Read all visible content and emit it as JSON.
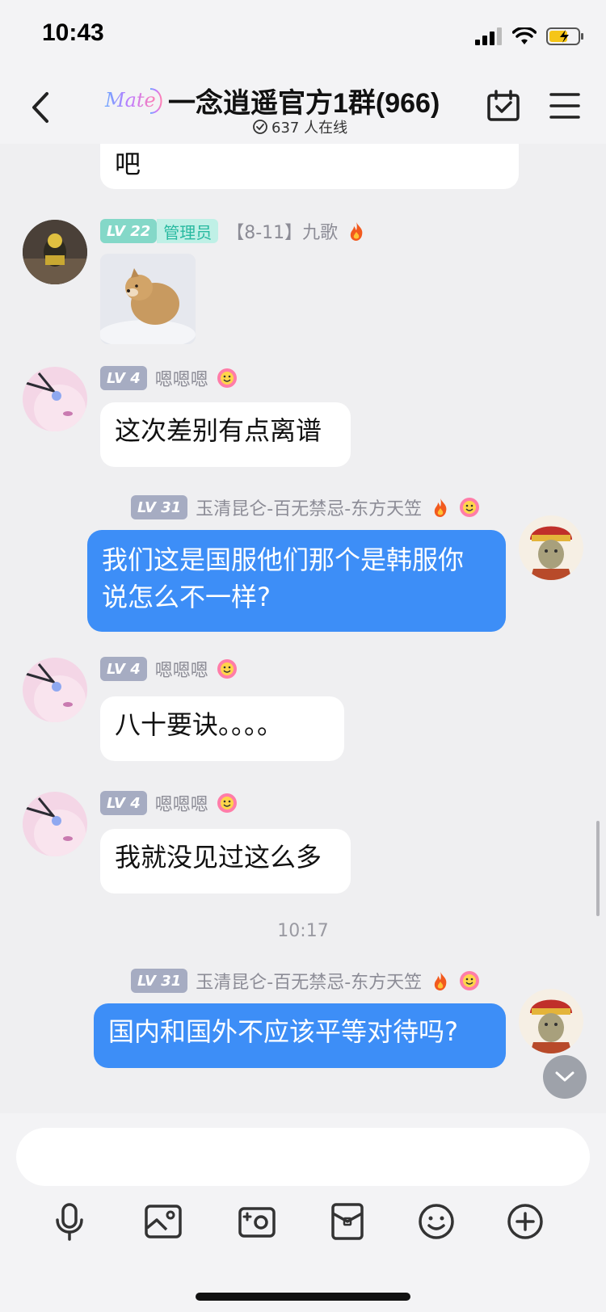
{
  "status_bar": {
    "time": "10:43"
  },
  "header": {
    "brand": "Mate",
    "group_title": "一念逍遥官方1群(966)",
    "online_text": "637 人在线"
  },
  "messages": [
    {
      "id": "m0",
      "text": "吧"
    },
    {
      "id": "m1",
      "level": "LV 22",
      "role": "管理员",
      "nickname": "【8-11】九歌",
      "type": "image"
    },
    {
      "id": "m2",
      "level": "LV 4",
      "nickname": "嗯嗯嗯",
      "text": "这次差别有点离谱"
    },
    {
      "id": "m3",
      "level": "LV 31",
      "nickname": "玉清昆仑-百无禁忌-东方天笠",
      "text_line1": "我们这是国服他们那个是韩服你",
      "text_line2": "说怎么不一样?",
      "self": true
    },
    {
      "id": "m4",
      "level": "LV 4",
      "nickname": "嗯嗯嗯",
      "text": "八十要诀。。。。"
    },
    {
      "id": "m5",
      "level": "LV 4",
      "nickname": "嗯嗯嗯",
      "text": "我就没见过这么多"
    },
    {
      "id": "m6",
      "level": "LV 31",
      "nickname": "玉清昆仑-百无禁忌-东方天笠",
      "text": "国内和国外不应该平等对待吗?",
      "self": true
    }
  ],
  "timestamp": "10:17",
  "input": {
    "placeholder": ""
  },
  "toolbar": [
    "microphone-icon",
    "image-icon",
    "camera-icon",
    "red-packet-icon",
    "emoji-icon",
    "plus-icon"
  ],
  "colors": {
    "accent": "#3d8ef7",
    "background": "#efeff1",
    "admin": "#28b9a0"
  }
}
